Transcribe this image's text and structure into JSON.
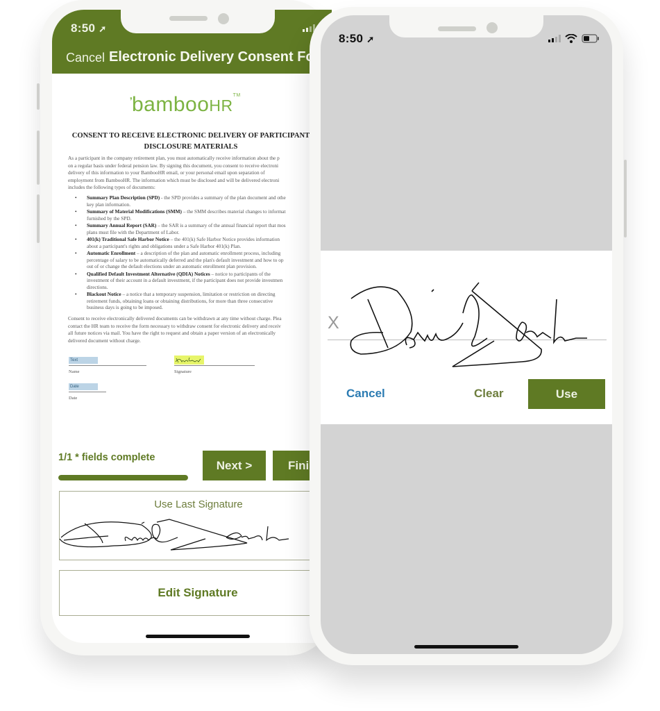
{
  "left_phone": {
    "status_bar": {
      "time": "8:50"
    },
    "nav": {
      "cancel_label": "Cancel",
      "title": "Electronic Delivery Consent For"
    },
    "document": {
      "logo_text": "bamboo",
      "logo_hr": "HR",
      "logo_tm": "TM",
      "title_line1": "CONSENT TO RECEIVE ELECTRONIC DELIVERY OF PARTICIPANT",
      "title_line2": "DISCLOSURE MATERIALS",
      "intro_lines": [
        "As a participant in the company retirement plan, you must automatically receive information about the p",
        "on a regular basis under federal pension law. By signing this document, you consent to receive electroni",
        "delivery of this information to your BambooHR email, or your personal email upon separation of",
        "employment from BambooHR. The information which must be disclosed and will be delivered electroni",
        "includes the following types of documents:"
      ],
      "items": [
        {
          "term": "Summary Plan Description (SPD)",
          "lines": [
            " - the SPD provides a summary of the plan document and othe",
            "key plan information."
          ]
        },
        {
          "term": "Summary of Material Modifications (SMM)",
          "lines": [
            " – the SMM describes material changes to informat",
            "furnished by the SPD."
          ]
        },
        {
          "term": "Summary Annual Report (SAR)",
          "lines": [
            " – the SAR is a summary of the annual financial report that mos",
            "plans must file with the Department of Labor."
          ]
        },
        {
          "term": "401(k) Traditional Safe Harbor Notice",
          "lines": [
            " – the 401(k) Safe Harbor Notice provides information",
            "about a participant's rights and obligations under a Safe Harbor 401(k) Plan."
          ]
        },
        {
          "term": "Automatic Enrollment",
          "lines": [
            " – a description of the plan and automatic enrollment process, including",
            "percentage of salary to be automatically deferred and the plan's default investment and how to op",
            "out of or change the default elections under an automatic enrollment plan provision."
          ]
        },
        {
          "term": "Qualified Default Investment Alternative (QDIA) Notices",
          "lines": [
            " – notice to participants of the",
            "investment of their account in a default investment, if the participant does not provide investmen",
            "directions."
          ]
        },
        {
          "term": "Blackout Notice",
          "lines": [
            " – a notice that a temporary suspension, limitation or restriction on directing",
            "retirement funds, obtaining loans or obtaining distributions, for more than three consecutive",
            "business days is going to be imposed."
          ]
        }
      ],
      "closing_lines": [
        "Consent to receive electronically delivered documents can be withdrawn at any time without charge. Plea",
        "contact the HR team to receive the form necessary to withdraw consent for electronic delivery and receiv",
        "all future notices via mail. You have the right to request and obtain a paper version of an electronically",
        "delivered document without charge."
      ],
      "fields": {
        "name_placeholder": "Text",
        "name_label": "Name",
        "signature_label": "Signature",
        "date_placeholder": "Date",
        "date_label": "Date"
      }
    },
    "progress": {
      "label": "1/1 * fields complete",
      "completed": 1,
      "total": 1
    },
    "buttons": {
      "next_label": "Next >",
      "finish_label": "Finish"
    },
    "use_last_signature_label": "Use Last Signature",
    "edit_signature_label": "Edit Signature"
  },
  "right_phone": {
    "status_bar": {
      "time": "8:50"
    },
    "signature_pad": {
      "x_mark": "X",
      "cancel_label": "Cancel",
      "clear_label": "Clear",
      "use_label": "Use"
    }
  },
  "colors": {
    "brand_green": "#5f7a24",
    "logo_green": "#7cb342",
    "link_blue": "#2b7bb2",
    "field_highlight": "#bcd4e6",
    "signature_highlight": "#e7f56a",
    "pad_background": "#d3d3d3"
  }
}
